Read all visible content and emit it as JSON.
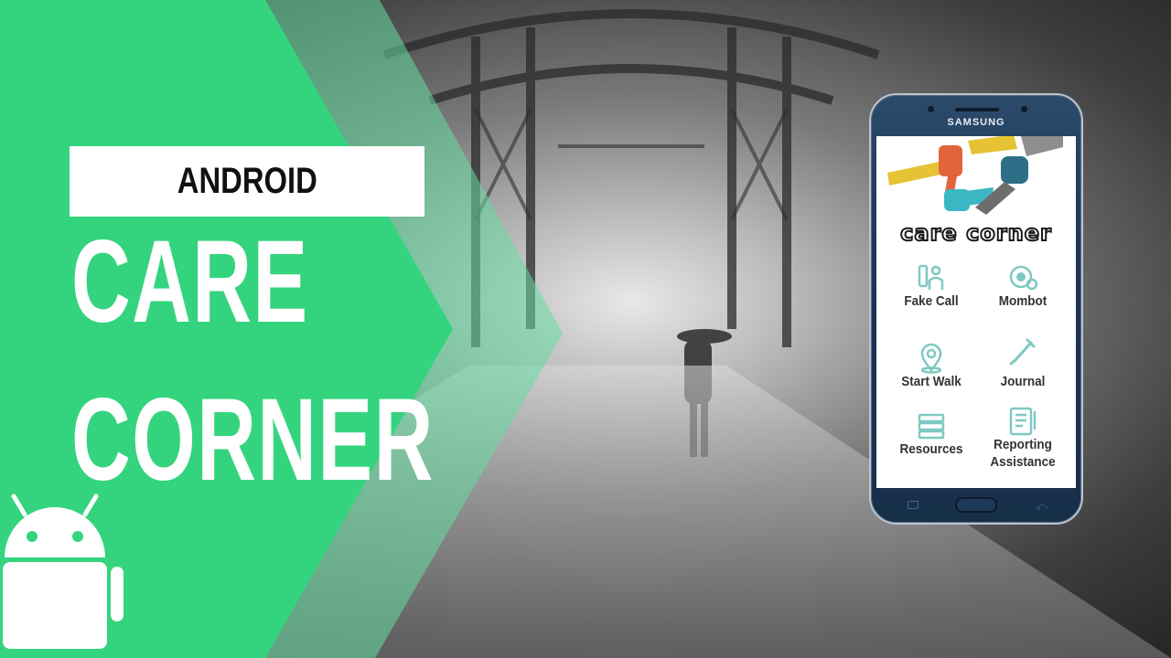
{
  "banner": {
    "platform_label": "ANDROID",
    "title_line_1": "CARE",
    "title_line_2": "CORNER"
  },
  "phone": {
    "brand": "SAMSUNG",
    "app": {
      "name": "care corner",
      "menu": [
        {
          "label": "Fake Call",
          "icon": "phone-person-icon"
        },
        {
          "label": "Mombot",
          "icon": "chatbot-icon"
        },
        {
          "label": "Start Walk",
          "icon": "location-pin-icon"
        },
        {
          "label": "Journal",
          "icon": "pen-icon"
        },
        {
          "label": "Resources",
          "icon": "books-icon"
        },
        {
          "label": "Reporting Assistance",
          "icon": "report-document-icon"
        }
      ]
    }
  },
  "colors": {
    "green": "#34d47e",
    "green_overlay": "#64dca0",
    "icon_teal": "#7ec9c1"
  }
}
